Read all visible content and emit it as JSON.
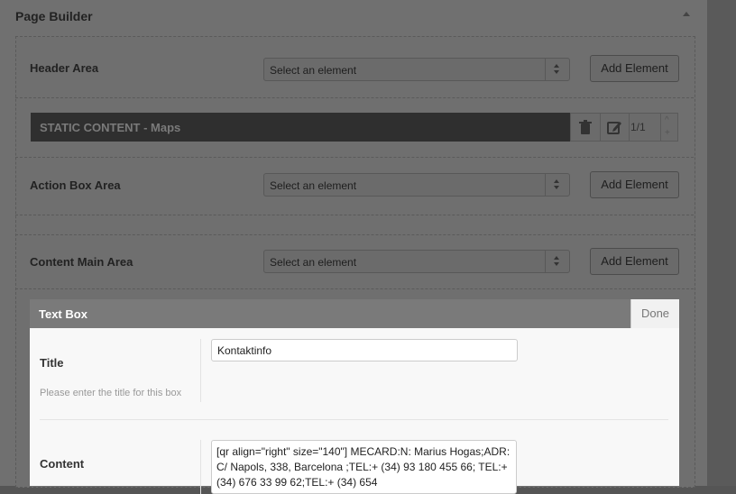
{
  "page_builder": {
    "title": "Page Builder"
  },
  "areas": [
    {
      "label": "Header Area",
      "select_value": "Select an element",
      "button": "Add Element"
    },
    {
      "label": "Action Box Area",
      "select_value": "Select an element",
      "button": "Add Element"
    },
    {
      "label": "Content Main Area",
      "select_value": "Select an element",
      "button": "Add Element"
    }
  ],
  "static_content": {
    "label": "STATIC CONTENT - Maps",
    "page_count": "1/1",
    "up": "^",
    "down": "+"
  },
  "modal": {
    "title": "Text Box",
    "done": "Done",
    "title_field": {
      "label": "Title",
      "description": "Please enter the title for this box",
      "value": "Kontaktinfo"
    },
    "content_field": {
      "label": "Content",
      "value": "[qr align=\"right\" size=\"140\"] MECARD:N: Marius Hogas;ADR: C/ Napols, 338, Barcelona ;TEL:+ (34) 93 180 455 66; TEL:+ (34) 676 33 99 62;TEL:+ (34) 654"
    }
  },
  "icons": {
    "collapse": "triangle-up-icon",
    "delete": "trash-icon",
    "edit": "edit-icon"
  }
}
